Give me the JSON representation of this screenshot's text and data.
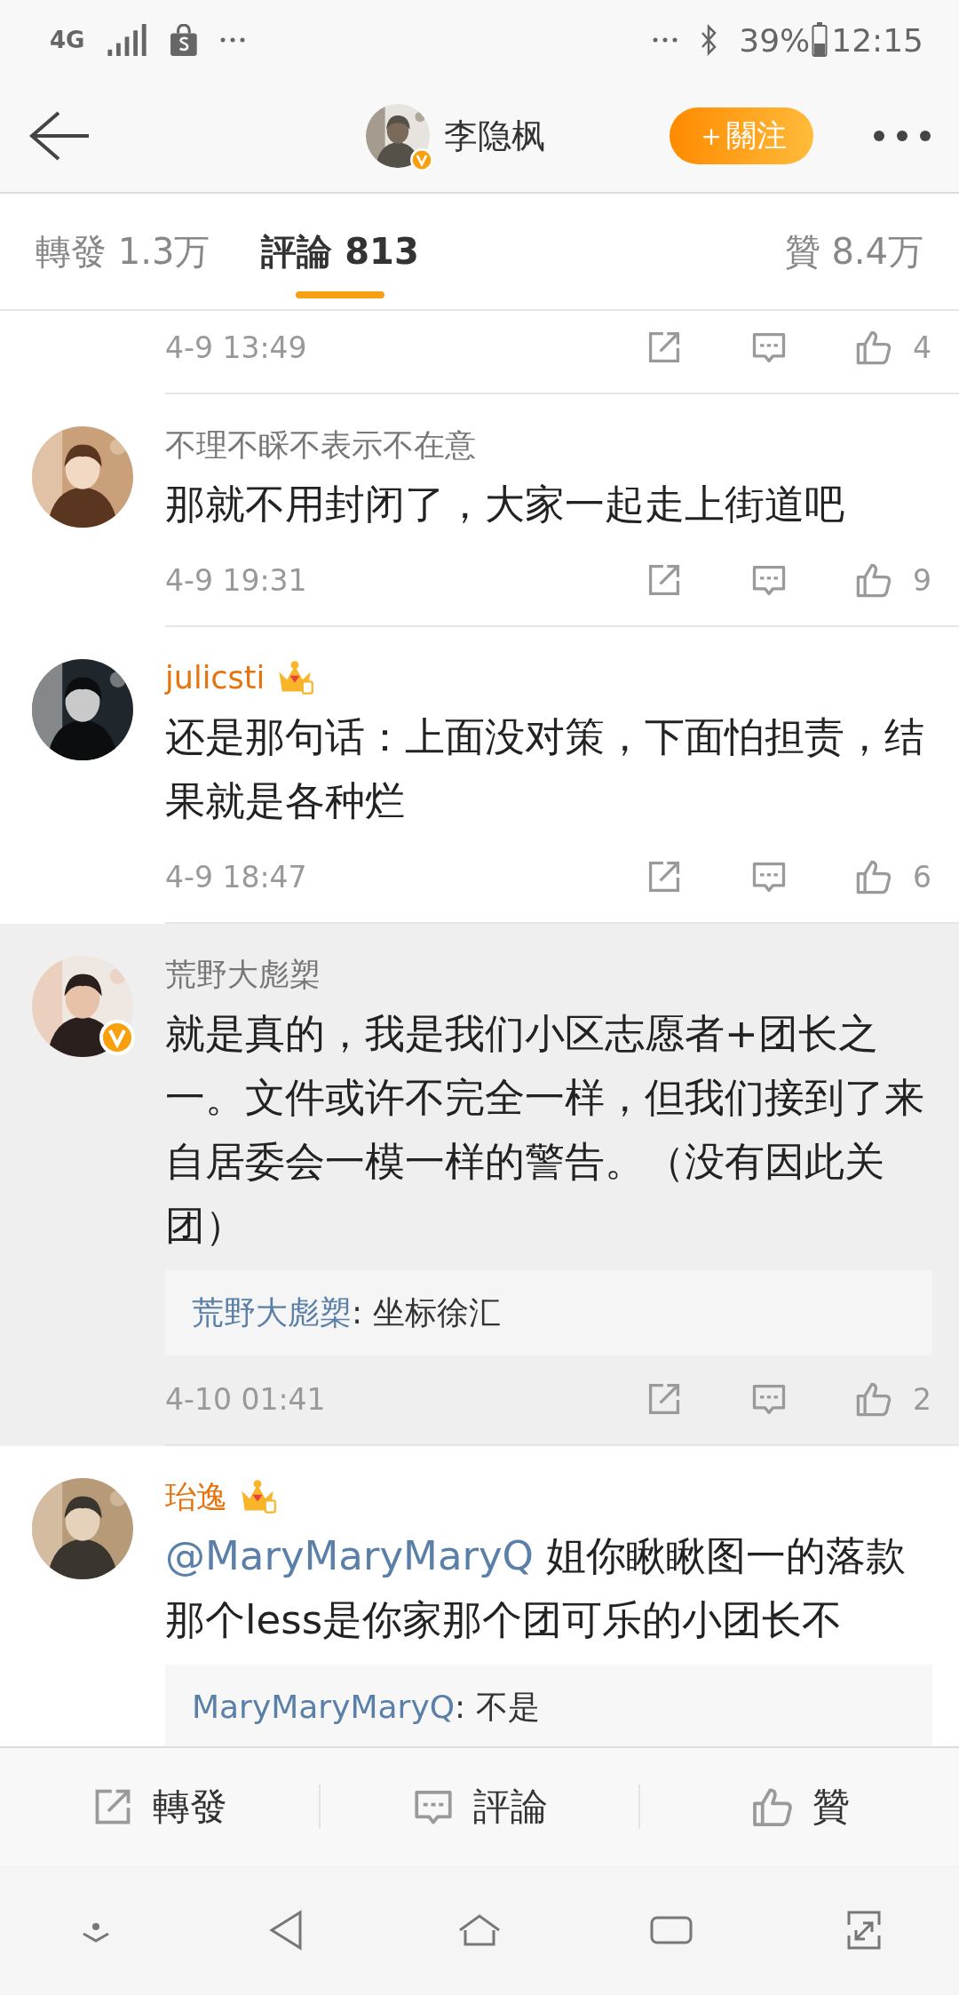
{
  "status_bar": {
    "network": "4G",
    "battery": "39%",
    "time": "12:15"
  },
  "header": {
    "user_name": "李隐枫",
    "verified": true,
    "follow_button": "＋關注"
  },
  "tabs": [
    {
      "label": "轉發 1.3万",
      "selected": false
    },
    {
      "label": "評論 813",
      "selected": true
    },
    {
      "label": "贊 8.4万",
      "selected": false
    }
  ],
  "comments": [
    {
      "kind": "partial",
      "highlighted": false,
      "time": "4-9 13:49",
      "likes": "4"
    },
    {
      "kind": "full",
      "highlighted": false,
      "user": "不理不睬不表示不在意",
      "member": false,
      "verified": false,
      "text": "那就不用封闭了，大家一起走上街道吧",
      "time": "4-9 19:31",
      "likes": "9"
    },
    {
      "kind": "full",
      "highlighted": false,
      "user": "julicsti",
      "member": true,
      "verified": false,
      "text": "还是那句话：上面没对策，下面怕担责，结果就是各种烂",
      "time": "4-9 18:47",
      "likes": "6"
    },
    {
      "kind": "full",
      "highlighted": true,
      "user": "荒野大彪槊",
      "member": false,
      "verified": true,
      "text": "就是真的，我是我们小区志愿者+团长之一。文件或许不完全一样，但我们接到了来自居委会一模一样的警告。（没有因此关团）",
      "reply": {
        "author": "荒野大彪槊",
        "text": ": 坐标徐汇"
      },
      "time": "4-10 01:41",
      "likes": "2"
    },
    {
      "kind": "full",
      "highlighted": false,
      "user": "珆逸",
      "member": true,
      "verified": false,
      "mention": "@MaryMaryMaryQ",
      "text": " 姐你瞅瞅图一的落款那个less是你家那个团可乐的小团长不",
      "reply": {
        "author": "MaryMaryMaryQ",
        "text": ": 不是"
      }
    }
  ],
  "bottom_bar": [
    {
      "kind": "repost",
      "label": "轉發"
    },
    {
      "kind": "comment",
      "label": "評論"
    },
    {
      "kind": "like",
      "label": "贊"
    }
  ]
}
